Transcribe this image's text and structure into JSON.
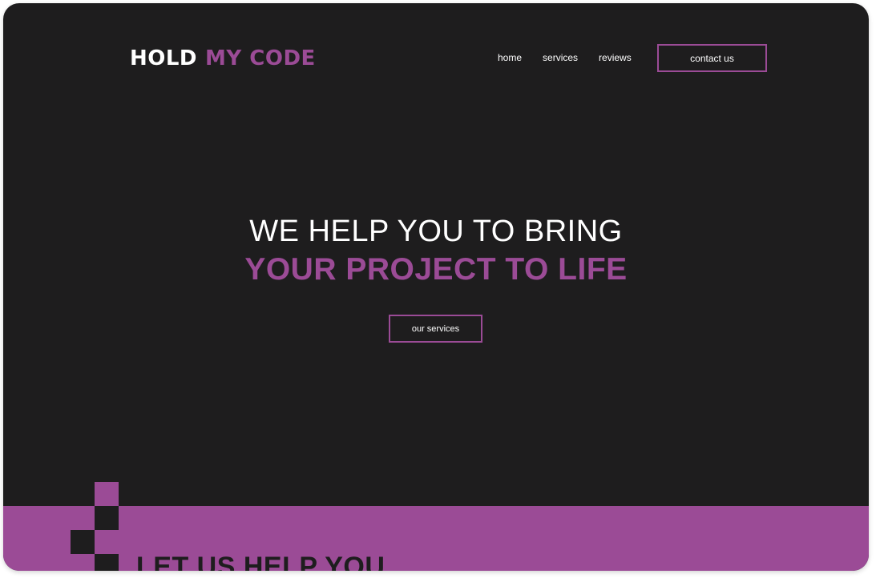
{
  "header": {
    "logo": {
      "part1": "HOLD",
      "part2": "MY CODE"
    },
    "nav": {
      "items": [
        "home",
        "services",
        "reviews"
      ],
      "contact_label": "contact us"
    }
  },
  "hero": {
    "line1": "WE HELP YOU TO BRING",
    "line2": "YOUR PROJECT TO LIFE",
    "cta_label": "our services"
  },
  "section": {
    "title": "LET US HELP YOU"
  },
  "colors": {
    "background": "#1e1d1e",
    "accent": "#9b4b96",
    "text": "#ffffff"
  }
}
